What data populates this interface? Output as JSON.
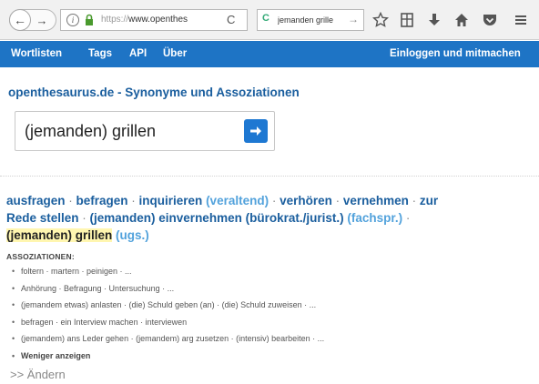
{
  "browser": {
    "back_symbol": "←",
    "forward_symbol": "→",
    "info_symbol": "i",
    "url_dim": "https://",
    "url_main": "www.openthes",
    "reload_symbol": "C",
    "search_engine_symbol": "C",
    "search_text": "jemanden grille",
    "search_go_symbol": "→",
    "toolbar_icons": [
      "star-icon",
      "reading-list-icon",
      "download-icon",
      "home-icon",
      "pocket-icon",
      "menu-icon"
    ]
  },
  "site_nav": {
    "left": [
      "Wortlisten",
      "Tags",
      "API",
      "Über"
    ],
    "right": "Einloggen und mitmachen",
    "color": "#1e74c5"
  },
  "page": {
    "title": "openthesaurus.de - Synonyme und Assoziationen",
    "search_value": "(jemanden) grillen",
    "submit_symbol": "→"
  },
  "synonyms": {
    "line1": [
      {
        "t": "ausfragen",
        "c": "w"
      },
      {
        "t": " · ",
        "c": "sep"
      },
      {
        "t": "befragen",
        "c": "w"
      },
      {
        "t": " · ",
        "c": "sep"
      },
      {
        "t": "inquirieren",
        "c": "w"
      },
      {
        "t": " (veraltend)",
        "c": "tag"
      },
      {
        "t": " · ",
        "c": "sep"
      },
      {
        "t": "verhören",
        "c": "w"
      },
      {
        "t": " · ",
        "c": "sep"
      },
      {
        "t": "vernehmen",
        "c": "w"
      },
      {
        "t": " · ",
        "c": "sep"
      },
      {
        "t": "zur",
        "c": "w"
      }
    ],
    "line2": [
      {
        "t": "Rede stellen",
        "c": "w"
      },
      {
        "t": " · ",
        "c": "sep"
      },
      {
        "t": "(jemanden) einvernehmen",
        "c": "w"
      },
      {
        "t": " (bürokrat./jurist.)",
        "c": "w"
      },
      {
        "t": " (fachspr.)",
        "c": "tag"
      },
      {
        "t": " ·",
        "c": "sep"
      }
    ],
    "line3": [
      {
        "t": "(jemanden) grillen",
        "c": "hl"
      },
      {
        "t": " (ugs.)",
        "c": "tag"
      }
    ]
  },
  "associations": {
    "title": "ASSOZIATIONEN:",
    "items": [
      "foltern · martern · peinigen · ...",
      "Anhörung · Befragung · Untersuchung · ...",
      "(jemandem etwas) anlasten · (die) Schuld geben (an) · (die) Schuld zuweisen · ...",
      "befragen · ein Interview machen · interviewen",
      "(jemandem) ans Leder gehen · (jemandem) arg zusetzen · (intensiv) bearbeiten · ..."
    ],
    "less_label": "Weniger anzeigen"
  },
  "change_link": ">> Ändern"
}
